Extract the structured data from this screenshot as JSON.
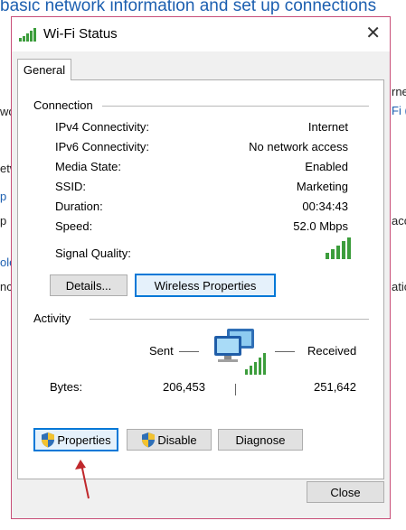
{
  "background": {
    "header_text": "basic network information and set up connections",
    "fragments": [
      {
        "text": "rne",
        "link": false
      },
      {
        "text": "Fi (",
        "link": true
      },
      {
        "text": "wo",
        "link": false
      },
      {
        "text": "etw",
        "link": false
      },
      {
        "text": "p",
        "link": true
      },
      {
        "text": "p",
        "link": false
      },
      {
        "text": "acc",
        "link": false
      },
      {
        "text": "ole",
        "link": true
      },
      {
        "text": "nc",
        "link": false
      },
      {
        "text": "atic",
        "link": false
      }
    ]
  },
  "dialog": {
    "title": "Wi-Fi Status",
    "close_glyph": "✕",
    "tab_label": "General",
    "connection": {
      "heading": "Connection",
      "rows": [
        {
          "label": "IPv4 Connectivity:",
          "value": "Internet"
        },
        {
          "label": "IPv6 Connectivity:",
          "value": "No network access"
        },
        {
          "label": "Media State:",
          "value": "Enabled"
        },
        {
          "label": "SSID:",
          "value": "Marketing"
        },
        {
          "label": "Duration:",
          "value": "00:34:43"
        },
        {
          "label": "Speed:",
          "value": "52.0 Mbps"
        }
      ],
      "signal_label": "Signal Quality:",
      "signal_bars": 5,
      "details_button": "Details...",
      "wireless_button": "Wireless Properties"
    },
    "activity": {
      "heading": "Activity",
      "sent_label": "Sent",
      "received_label": "Received",
      "bytes_label": "Bytes:",
      "bytes_sent": "206,453",
      "bytes_received": "251,642"
    },
    "buttons": {
      "properties": "Properties",
      "disable": "Disable",
      "diagnose": "Diagnose",
      "close": "Close"
    }
  },
  "colors": {
    "accent": "#0078d7",
    "signal_green": "#3c9d3c",
    "dialog_border": "#c84e78",
    "annotation_arrow": "#c0282c",
    "link": "#1c5fb0"
  },
  "icons": {
    "title": "wifi-signal-icon",
    "activity": "network-computers-icon",
    "shield": "uac-shield-icon",
    "annotation": "red-arrow-icon"
  }
}
